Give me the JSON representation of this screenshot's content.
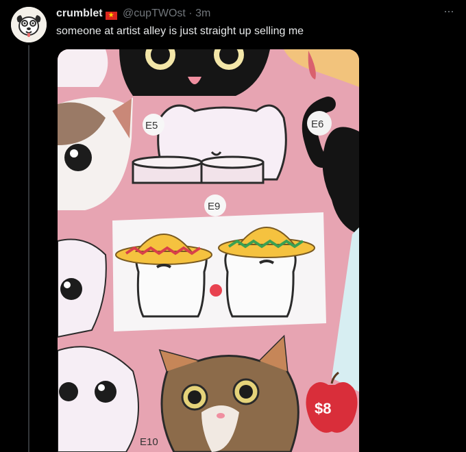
{
  "tweet": {
    "display_name": "crumblet",
    "flag": "★",
    "handle": "@cupTWOst",
    "separator": "·",
    "time": "3m",
    "text": "someone at artist alley is just straight up selling me",
    "more": "···"
  },
  "media": {
    "labels": {
      "e5": "E5",
      "e6": "E6",
      "e9": "E9",
      "e10": "E10"
    },
    "price": "$8"
  }
}
